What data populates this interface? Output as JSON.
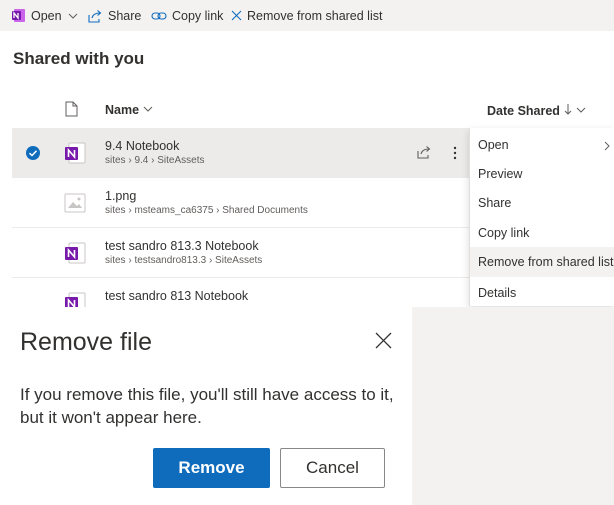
{
  "commandbar": {
    "open_label": "Open",
    "share_label": "Share",
    "copy_link_label": "Copy link",
    "remove_label": "Remove from shared list"
  },
  "page": {
    "title": "Shared with you"
  },
  "columns": {
    "name": "Name",
    "date_shared": "Date Shared"
  },
  "files": [
    {
      "name": "9.4 Notebook",
      "path": "sites › 9.4 › SiteAssets",
      "type": "onenote",
      "selected": true
    },
    {
      "name": "1.png",
      "path": "sites › msteams_ca6375 › Shared Documents",
      "type": "image",
      "selected": false
    },
    {
      "name": "test sandro 813.3 Notebook",
      "path": "sites › testsandro813.3 › SiteAssets",
      "type": "onenote",
      "selected": false
    },
    {
      "name": "test sandro 813 Notebook",
      "path": "",
      "type": "onenote",
      "selected": false
    }
  ],
  "context_menu": {
    "items": [
      {
        "label": "Open"
      },
      {
        "label": "Preview"
      },
      {
        "label": "Share"
      },
      {
        "label": "Copy link"
      },
      {
        "label": "Remove from shared list"
      },
      {
        "label": "Details"
      }
    ]
  },
  "dialog": {
    "title": "Remove file",
    "message": "If you remove this file, you'll still have access to it, but it won't appear here.",
    "primary_label": "Remove",
    "secondary_label": "Cancel"
  },
  "colors": {
    "accent": "#0f6cbd",
    "onenote": "#7719aa",
    "bar": "#f3f2f1"
  }
}
